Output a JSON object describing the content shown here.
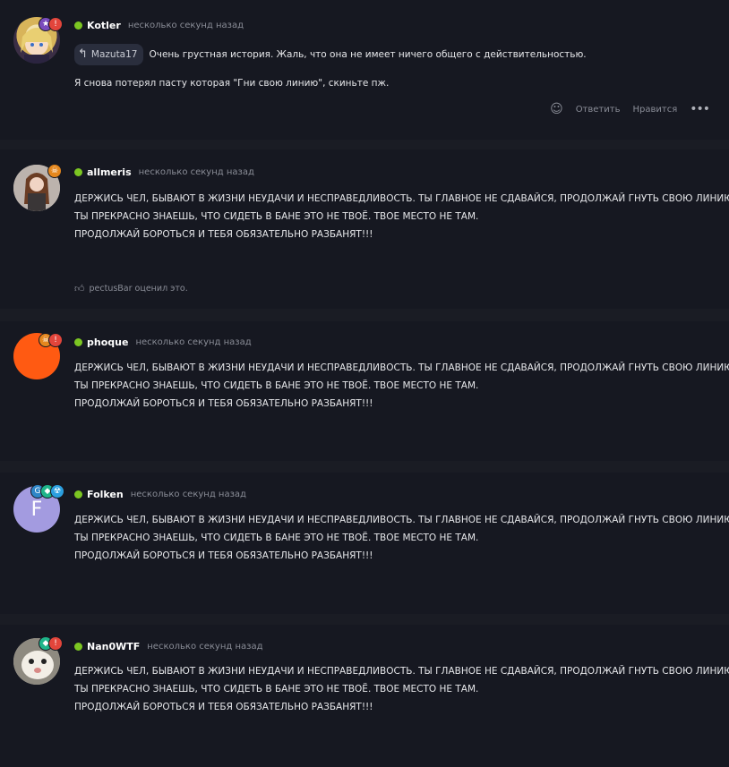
{
  "comments": [
    {
      "author": "Kotler",
      "time": "несколько секунд назад",
      "quote_user": "Mazuta17",
      "quote_text": "Очень грустная история. Жаль, что она не имеет ничего общего с действительностью.",
      "lines": [
        "Я снова потерял пасту которая \"Гни свою линию\", скиньте пж."
      ],
      "actions": {
        "reply": "Ответить",
        "like": "Нравится"
      }
    },
    {
      "author": "allmeris",
      "time": "несколько секунд назад",
      "lines": [
        "ДЕРЖИСЬ ЧЕЛ, БЫВАЮТ В ЖИЗНИ НЕУДАЧИ И НЕСПРАВЕДЛИВОСТЬ. ТЫ ГЛАВНОЕ НЕ СДАВАЙСЯ, ПРОДОЛЖАЙ ГНУТЬ СВОЮ ЛИНИЮ.",
        "ТЫ ПРЕКРАСНО ЗНАЕШЬ, ЧТО СИДЕТЬ В БАНЕ ЭТО НЕ ТВОЁ. ТВОЕ МЕСТО НЕ ТАМ.",
        "ПРОДОЛЖАЙ БОРОТЬСЯ И ТЕБЯ ОБЯЗАТЕЛЬНО РАЗБАНЯТ!!!"
      ],
      "liked_by": "pectusBar оценил это."
    },
    {
      "author": "phoque",
      "time": "несколько секунд назад",
      "lines": [
        "ДЕРЖИСЬ ЧЕЛ, БЫВАЮТ В ЖИЗНИ НЕУДАЧИ И НЕСПРАВЕДЛИВОСТЬ. ТЫ ГЛАВНОЕ НЕ СДАВАЙСЯ, ПРОДОЛЖАЙ ГНУТЬ СВОЮ ЛИНИЮ.",
        "ТЫ ПРЕКРАСНО ЗНАЕШЬ, ЧТО СИДЕТЬ В БАНЕ ЭТО НЕ ТВОЁ. ТВОЕ МЕСТО НЕ ТАМ.",
        "ПРОДОЛЖАЙ БОРОТЬСЯ И ТЕБЯ ОБЯЗАТЕЛЬНО РАЗБАНЯТ!!!"
      ]
    },
    {
      "author": "Folken",
      "avatar_letter": "F",
      "time": "несколько секунд назад",
      "lines": [
        "ДЕРЖИСЬ ЧЕЛ, БЫВАЮТ В ЖИЗНИ НЕУДАЧИ И НЕСПРАВЕДЛИВОСТЬ. ТЫ ГЛАВНОЕ НЕ СДАВАЙСЯ, ПРОДОЛЖАЙ ГНУТЬ СВОЮ ЛИНИЮ.",
        "ТЫ ПРЕКРАСНО ЗНАЕШЬ, ЧТО СИДЕТЬ В БАНЕ ЭТО НЕ ТВОЁ. ТВОЕ МЕСТО НЕ ТАМ.",
        "ПРОДОЛЖАЙ БОРОТЬСЯ И ТЕБЯ ОБЯЗАТЕЛЬНО РАЗБАНЯТ!!!"
      ]
    },
    {
      "author": "Nan0WTF",
      "time": "несколько секунд назад",
      "lines": [
        "ДЕРЖИСЬ ЧЕЛ, БЫВАЮТ В ЖИЗНИ НЕУДАЧИ И НЕСПРАВЕДЛИВОСТЬ. ТЫ ГЛАВНОЕ НЕ СДАВАЙСЯ, ПРОДОЛЖАЙ ГНУТЬ СВОЮ ЛИНИЮ.",
        "ТЫ ПРЕКРАСНО ЗНАЕШЬ, ЧТО СИДЕТЬ В БАНЕ ЭТО НЕ ТВОЁ. ТВОЕ МЕСТО НЕ ТАМ.",
        "ПРОДОЛЖАЙ БОРОТЬСЯ И ТЕБЯ ОБЯЗАТЕЛЬНО РАЗБАНЯТ!!!"
      ]
    }
  ],
  "colors": {
    "online": "#7cc622",
    "background": "#1a1c24",
    "card": "#161821",
    "muted": "#8a8d97"
  },
  "icons": {
    "reply": "reply-arrow-icon",
    "emoji": "emoji-add-icon",
    "more": "more-dots-icon",
    "thumb": "thumbs-up-icon"
  }
}
